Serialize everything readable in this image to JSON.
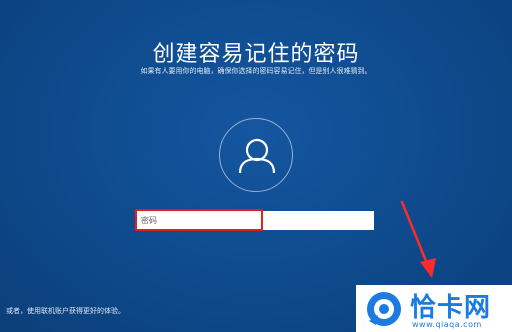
{
  "setup": {
    "title": "创建容易记住的密码",
    "subtitle": "如果有人要用你的电脑，确保你选择的密码容易记住，但是别人很难猜到。",
    "password_placeholder": "密码",
    "password_value": "",
    "alt_link": "或者，使用联机账户获得更好的体验。"
  },
  "icons": {
    "avatar": "user-avatar-icon",
    "arrow": "red-arrow-icon"
  },
  "watermark": {
    "name": "恰卡网",
    "url": "www.qiaqa.com"
  },
  "colors": {
    "background": "#0d4784",
    "highlight": "#e02020",
    "arrow": "#ff2a2a",
    "watermark_blue": "#1c7be0"
  }
}
